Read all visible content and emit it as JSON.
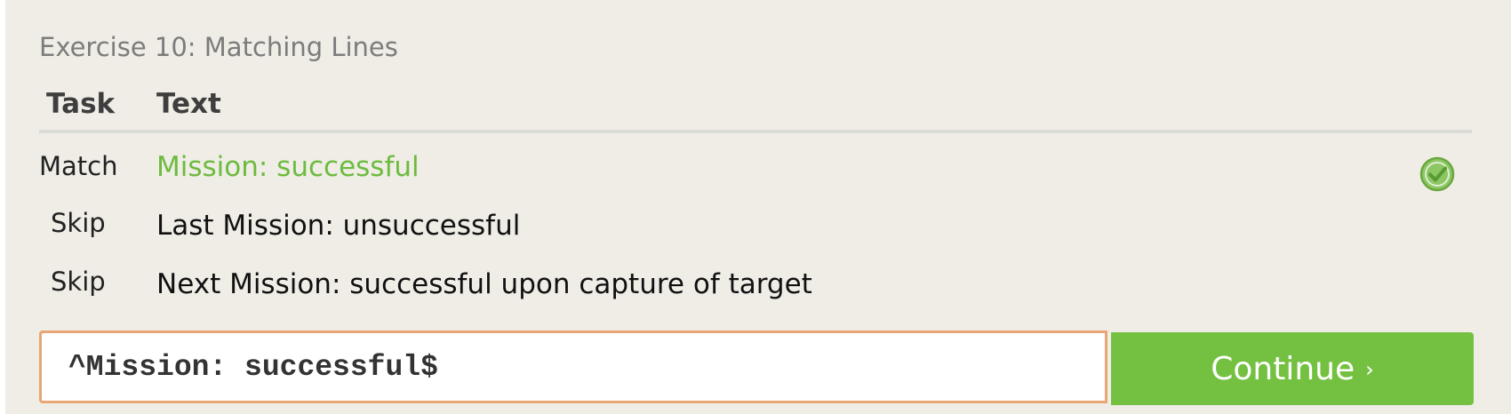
{
  "exercise": {
    "title": "Exercise 10: Matching Lines"
  },
  "table": {
    "headers": {
      "task": "Task",
      "text": "Text"
    },
    "rows": [
      {
        "task": "Match",
        "text": "Mission: successful",
        "status": "matched"
      },
      {
        "task": "Skip",
        "text": "Last Mission: unsuccessful",
        "status": "none"
      },
      {
        "task": "Skip",
        "text": "Next Mission: successful upon capture of target",
        "status": "none"
      }
    ]
  },
  "input": {
    "value": "^Mission: successful$"
  },
  "continue_button": {
    "label": "Continue",
    "chevron": "›"
  },
  "icons": {
    "row_status": "check-circle-icon"
  },
  "colors": {
    "background": "#efede6",
    "match_green": "#6dbb3f",
    "button_green": "#74c142",
    "input_border": "#e7a673"
  }
}
